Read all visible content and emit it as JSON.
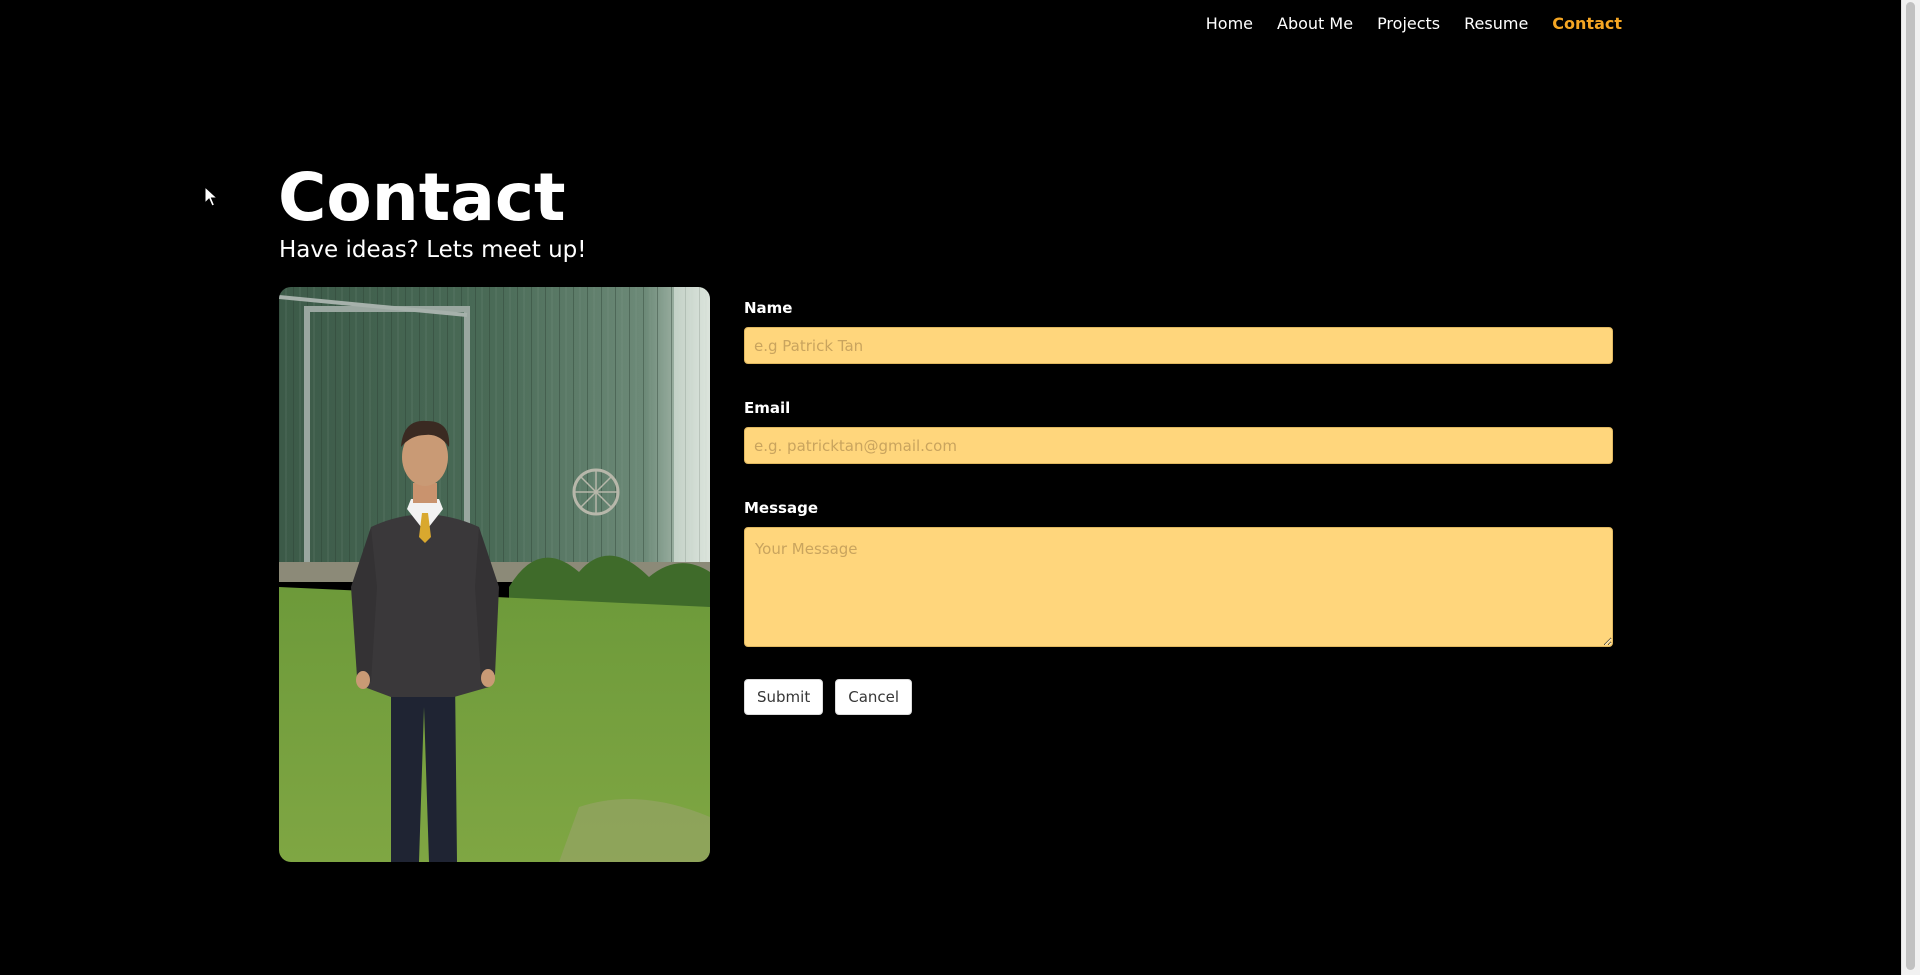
{
  "nav": {
    "items": [
      {
        "label": "Home",
        "active": false
      },
      {
        "label": "About Me",
        "active": false
      },
      {
        "label": "Projects",
        "active": false
      },
      {
        "label": "Resume",
        "active": false
      },
      {
        "label": "Contact",
        "active": true
      }
    ],
    "active_color": "#f5a623"
  },
  "header": {
    "title": "Contact",
    "subtitle": "Have ideas? Lets meet up!"
  },
  "photo": {
    "icon": "portrait-photo"
  },
  "form": {
    "name_label": "Name",
    "name_placeholder": "e.g Patrick Tan",
    "email_label": "Email",
    "email_placeholder": "e.g. patricktan@gmail.com",
    "message_label": "Message",
    "message_placeholder": "Your Message",
    "submit_label": "Submit",
    "cancel_label": "Cancel",
    "input_color": "#ffd67c"
  }
}
